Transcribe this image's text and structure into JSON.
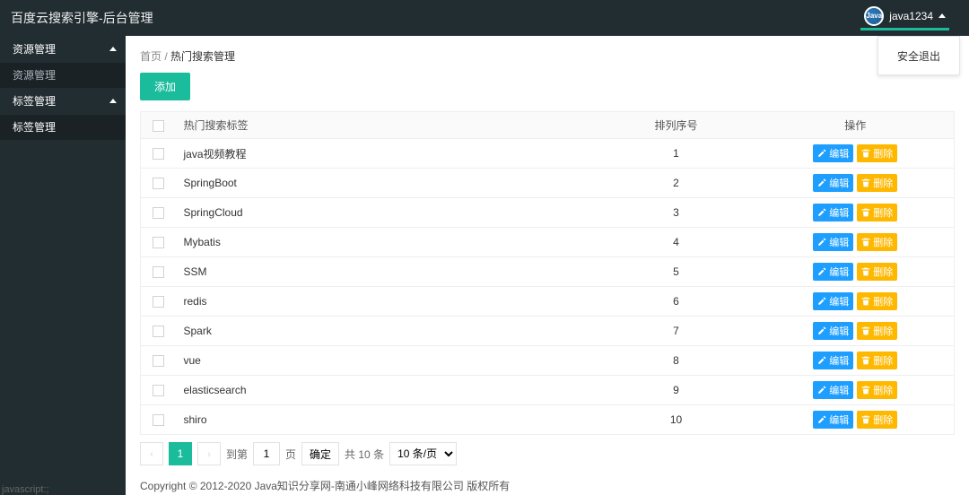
{
  "header": {
    "app_title": "百度云搜索引擎-后台管理",
    "username": "java1234",
    "logout_label": "安全退出"
  },
  "sidebar": {
    "groups": [
      {
        "label": "资源管理",
        "items": [
          {
            "label": "资源管理",
            "active": false
          }
        ]
      },
      {
        "label": "标签管理",
        "items": [
          {
            "label": "标签管理",
            "active": true
          }
        ]
      }
    ]
  },
  "breadcrumb": {
    "home": "首页",
    "sep": "/",
    "current": "热门搜索管理"
  },
  "actions": {
    "add": "添加",
    "edit": "编辑",
    "delete": "删除"
  },
  "table": {
    "columns": {
      "name": "热门搜索标签",
      "sort": "排列序号",
      "ops": "操作"
    },
    "rows": [
      {
        "name": "java视频教程",
        "sort": 1
      },
      {
        "name": "SpringBoot",
        "sort": 2
      },
      {
        "name": "SpringCloud",
        "sort": 3
      },
      {
        "name": "Mybatis",
        "sort": 4
      },
      {
        "name": "SSM",
        "sort": 5
      },
      {
        "name": "redis",
        "sort": 6
      },
      {
        "name": "Spark",
        "sort": 7
      },
      {
        "name": "vue",
        "sort": 8
      },
      {
        "name": "elasticsearch",
        "sort": 9
      },
      {
        "name": "shiro",
        "sort": 10
      }
    ]
  },
  "pager": {
    "page": 1,
    "goto_prefix": "到第",
    "goto_page_value": 1,
    "goto_suffix": "页",
    "confirm": "确定",
    "total_text": "共 10 条",
    "page_size_label": "10 条/页"
  },
  "footer": "Copyright © 2012-2020 Java知识分享网-南通小峰网络科技有限公司 版权所有",
  "status": {
    "javascript": "javascript:;"
  }
}
